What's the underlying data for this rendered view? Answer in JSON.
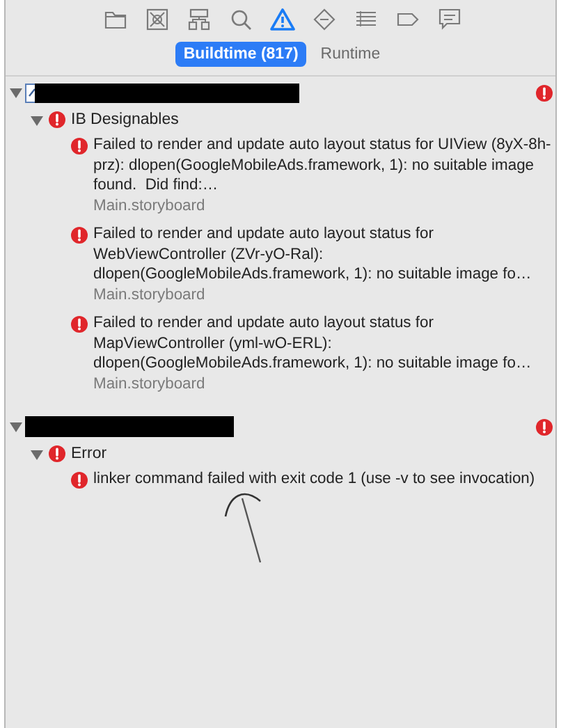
{
  "toolbar": {
    "icons": [
      {
        "kind": "folder",
        "selected": false
      },
      {
        "kind": "xbox",
        "selected": false
      },
      {
        "kind": "hierarchy",
        "selected": false
      },
      {
        "kind": "search",
        "selected": false
      },
      {
        "kind": "warning",
        "selected": true
      },
      {
        "kind": "diamond",
        "selected": false
      },
      {
        "kind": "list",
        "selected": false
      },
      {
        "kind": "tag",
        "selected": false
      },
      {
        "kind": "chat",
        "selected": false
      }
    ]
  },
  "segments": [
    {
      "label": "Buildtime (817)",
      "selected": true
    },
    {
      "label": "Runtime",
      "selected": false
    }
  ],
  "groups": [
    {
      "expanded": true,
      "file_icon": true,
      "categories": [
        {
          "label": "IB Designables",
          "expanded": true,
          "issues": [
            {
              "message": "Failed to render and update auto layout status for UIView (8yX-8h-prz): dlopen(GoogleMobileAds.framework, 1): no suitable image found.  Did find:…",
              "file": "Main.storyboard"
            },
            {
              "message": "Failed to render and update auto layout status for WebViewController (ZVr-yO-Ral): dlopen(GoogleMobileAds.framework, 1): no suitable image fo…",
              "file": "Main.storyboard"
            },
            {
              "message": "Failed to render and update auto layout status for MapViewController (yml-wO-ERL): dlopen(GoogleMobileAds.framework, 1): no suitable image fo…",
              "file": "Main.storyboard"
            }
          ]
        }
      ]
    },
    {
      "expanded": true,
      "file_icon": false,
      "categories": [
        {
          "label": "Error",
          "expanded": true,
          "issues": [
            {
              "message": "linker command failed with exit code 1 (use -v to see invocation)"
            }
          ]
        }
      ]
    }
  ]
}
